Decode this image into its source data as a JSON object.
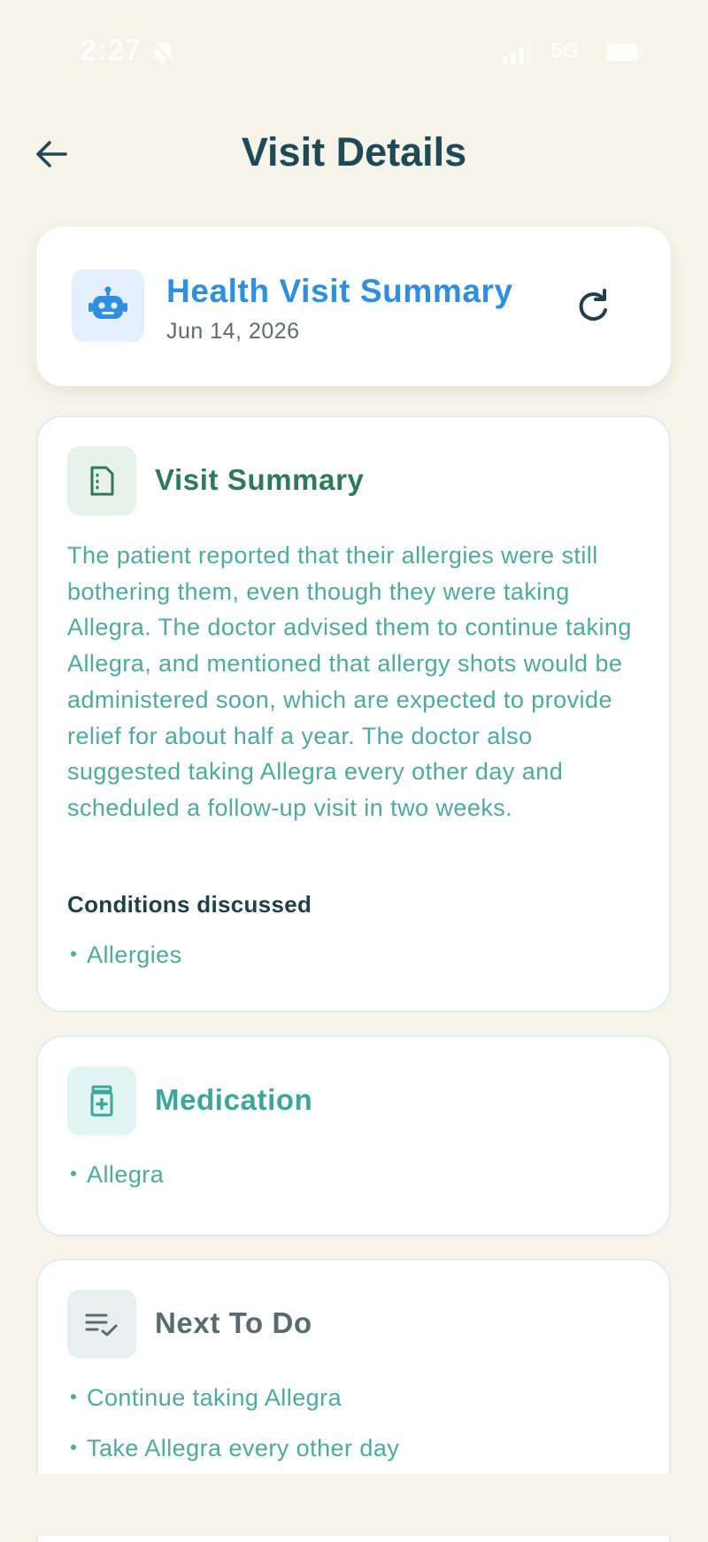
{
  "status_bar": {
    "time": "2:27",
    "network": "5G"
  },
  "header": {
    "title": "Visit Details"
  },
  "report": {
    "title": "Health Visit Summary",
    "date": "Jun 14, 2026"
  },
  "visit_summary": {
    "title": "Visit Summary",
    "text": "The patient reported that their allergies were still bothering them, even though they were taking Allegra. The doctor advised them to continue taking Allegra, and mentioned that allergy shots would be administered soon, which are expected to provide relief for about half a year. The doctor also suggested taking Allegra every other day and scheduled a follow-up visit in two weeks.",
    "conditions_label": "Conditions discussed",
    "conditions": [
      "Allergies"
    ]
  },
  "medication": {
    "title": "Medication",
    "items": [
      "Allegra"
    ]
  },
  "next_to_do": {
    "title": "Next To Do",
    "items": [
      "Continue taking Allegra",
      "Take Allegra every other day"
    ]
  },
  "colors": {
    "background": "#F6F3E8",
    "title_dark": "#1E4A58",
    "accent_blue": "#2E8FE0",
    "accent_green": "#2D7A58",
    "accent_teal": "#3AA79C",
    "body_teal": "#4AAB9E",
    "muted_grey": "#566C70"
  },
  "icons": {
    "back": "arrow-left-icon",
    "bot": "robot-icon",
    "refresh": "refresh-icon",
    "summary": "document-icon",
    "medication": "medicine-bottle-icon",
    "todo": "checklist-icon",
    "bell_muted": "bell-slash-icon",
    "signal": "signal-bars-icon",
    "battery": "battery-icon"
  }
}
